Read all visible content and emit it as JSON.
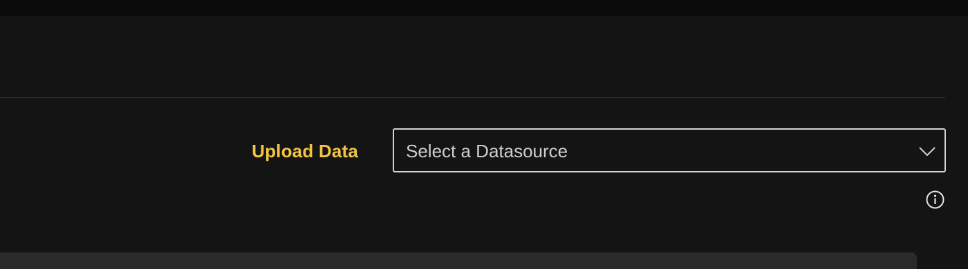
{
  "upload": {
    "label": "Upload Data",
    "label_color": "#f3c544"
  },
  "datasource_select": {
    "selected_text": "Select a Datasource",
    "options": []
  },
  "icons": {
    "dropdown": "chevron-down-icon",
    "info": "info-icon"
  }
}
